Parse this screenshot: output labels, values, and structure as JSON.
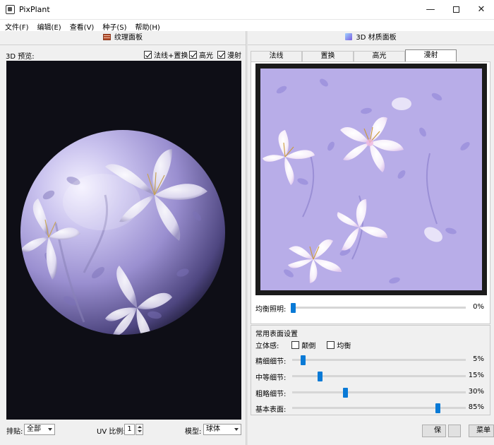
{
  "window": {
    "title": "PixPlant",
    "min_icon": "minimize-icon",
    "max_icon": "maximize-icon",
    "close_icon": "close-icon"
  },
  "menu": [
    {
      "label": "文件(F)"
    },
    {
      "label": "编辑(E)"
    },
    {
      "label": "查看(V)"
    },
    {
      "label": "种子(S)"
    },
    {
      "label": "帮助(H)"
    }
  ],
  "texture_panel": {
    "header": "纹理面板",
    "preview_label": "3D 预览:",
    "checkboxes": [
      {
        "label": "法线+置换",
        "checked": true
      },
      {
        "label": "高光",
        "checked": true
      },
      {
        "label": "漫射",
        "checked": true
      }
    ],
    "tiling_label": "排贴:",
    "tiling_value": "全部",
    "uv_label": "UV 比例:",
    "uv_value": "1",
    "model_label": "模型:",
    "model_value": "球体"
  },
  "material_panel": {
    "header": "3D 材质面板",
    "tabs": [
      {
        "label": "法线",
        "active": false
      },
      {
        "label": "置换",
        "active": false
      },
      {
        "label": "高光",
        "active": false
      },
      {
        "label": "漫射",
        "active": true
      }
    ],
    "balance_light": {
      "label": "均衡照明:",
      "value": "0%",
      "fraction": 0.0
    },
    "surface_group": {
      "title": "常用表面设置",
      "bump_label": "立体感:",
      "invert_label": "颠倒",
      "invert_checked": false,
      "balance_label": "均衡",
      "balance_checked": false,
      "sliders": [
        {
          "label": "精细细节:",
          "value": "5%",
          "fraction": 0.05
        },
        {
          "label": "中等细节:",
          "value": "15%",
          "fraction": 0.15
        },
        {
          "label": "粗略细节:",
          "value": "30%",
          "fraction": 0.3
        },
        {
          "label": "基本表面:",
          "value": "85%",
          "fraction": 0.85
        }
      ]
    },
    "buttons": [
      {
        "label": "保存"
      },
      {
        "label": ""
      },
      {
        "label": "菜单"
      }
    ]
  },
  "colors": {
    "accent": "#0a7ad6",
    "texture_bg": "#b7abe6",
    "preview_bg": "#0e0e16"
  }
}
